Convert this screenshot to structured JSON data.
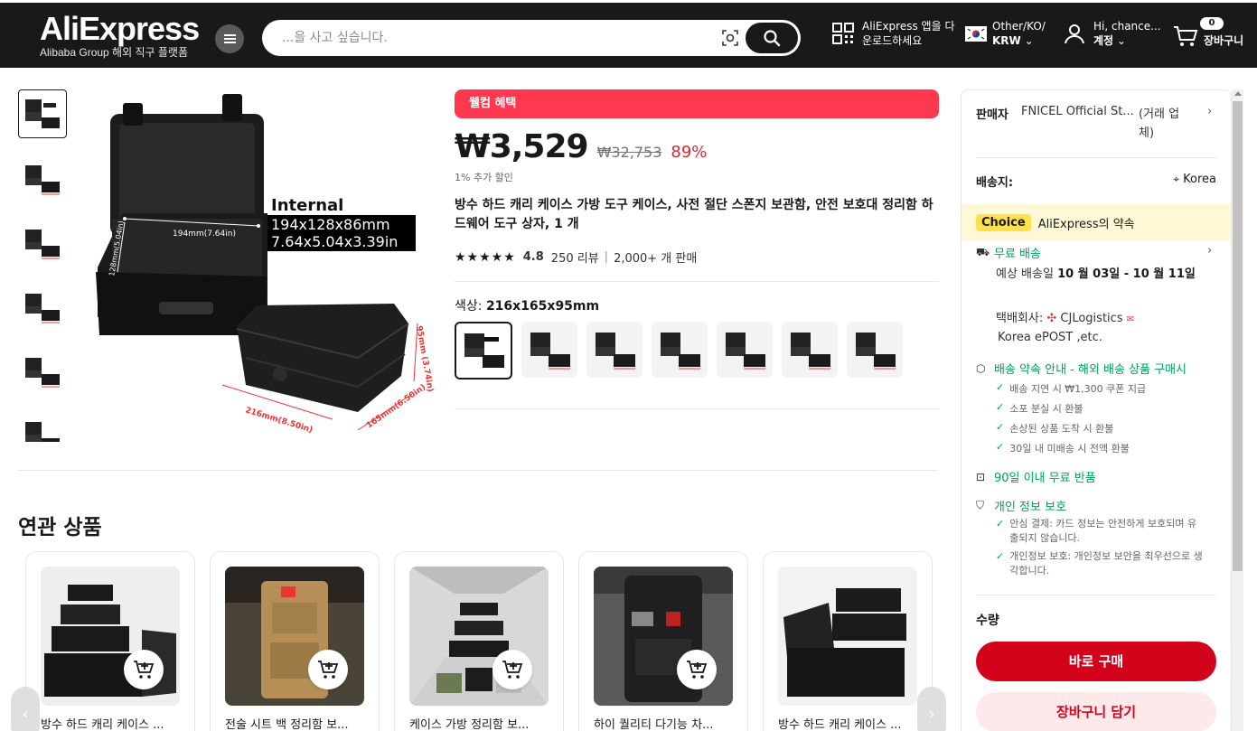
{
  "header": {
    "logo_text": "AliExpress",
    "logo_sub": "Alibaba Group 해외 직구 플랫폼",
    "search_placeholder": "...을 사고 싶습니다.",
    "app_line1": "AliExpress 앱을 다",
    "app_line2": "운로드하세요",
    "lang_line1": "Other/KO/",
    "lang_line2": "KRW",
    "account_line1": "Hi, chance...",
    "account_line2": "계정",
    "cart_count": "0",
    "cart_label": "장바구니"
  },
  "product": {
    "welcome_label": "웰컴 혜택",
    "price": "₩3,529",
    "original_price": "₩32,753",
    "discount": "89%",
    "extra_discount": "1% 추가 할인",
    "title": "방수 하드 캐리 케이스 가방 도구 케이스, 사전 절단 스폰지 보관함, 안전 보호대 정리함 하드웨어 도구 상자, 1 개",
    "rating_value": "4.8",
    "reviews": "250 리뷰",
    "sold": "2,000+ 개 판매",
    "color_label": "색상:",
    "color_value": "216x165x95mm",
    "image_annotations": {
      "internal": "Internal",
      "dim_mm": "194x128x86mm",
      "dim_in": "7.64x5.04x3.39in",
      "w_label": "194mm(7.64in)",
      "h_label": "128mm(5.04in)",
      "ext_w": "216mm(8.50in)",
      "ext_d": "165mm(6.50in)",
      "ext_h": "95mm (3.74in)"
    }
  },
  "related": {
    "heading": "연관 상품",
    "items": [
      {
        "title": "방수 하드 캐리 케이스 ..."
      },
      {
        "title": "전술 시트 백 정리함 보..."
      },
      {
        "title": "케이스 가방 정리함 보..."
      },
      {
        "title": "하이 퀄리티 다기능 차..."
      },
      {
        "title": "방수 하드 캐리 케이스 ..."
      }
    ]
  },
  "sidebar": {
    "seller_label": "판매자",
    "seller_name": "FNICEL Official St...",
    "seller_type": "(거래 업체)",
    "ship_label": "배송지:",
    "ship_to": "Korea",
    "choice_badge": "Choice",
    "choice_text": "AliExpress의 약속",
    "free_shipping": "무료 배송",
    "delivery_prefix": "예상 배송일",
    "delivery_date": "10 월 03일 - 10 월 11일",
    "carrier_prefix": "택배회사:",
    "carrier_name": "CJLogistics",
    "carrier_more": "Korea ePOST ,etc.",
    "promise_title": "배송 약속 안내 - 해외 배송 상품 구매시",
    "promise_items": [
      "배송 지연 시 ₩1,300 쿠폰 지급",
      "소포 분실 시 환불",
      "손상된 상품 도착 시 환불",
      "30일 내 미배송 시 전액 환불"
    ],
    "return_text": "90일 이내 무료 반품",
    "privacy_title": "개인 정보 보호",
    "privacy_items": [
      "안심 결제: 카드 정보는 안전하게 보호되며 유출되지 않습니다.",
      "개인정보 보호: 개인정보 보안을 최우선으로 생각합니다."
    ],
    "qty_label": "수량",
    "buy_now": "바로 구매",
    "add_to_cart": "장바구니 담기"
  }
}
